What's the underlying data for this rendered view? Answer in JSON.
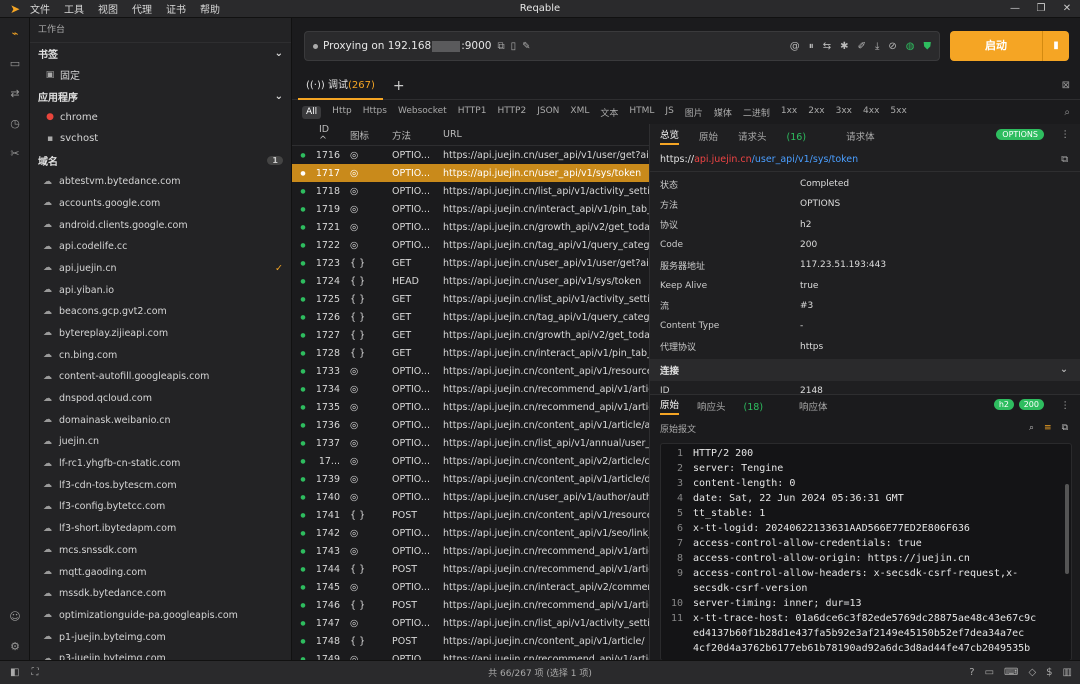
{
  "app": {
    "title": "Reqable",
    "menu": [
      "文件",
      "工具",
      "视图",
      "代理",
      "证书",
      "帮助"
    ]
  },
  "sidebar": {
    "workspace": "工作台",
    "bookmarks": {
      "title": "书签",
      "items": [
        {
          "label": "固定"
        }
      ]
    },
    "apps": {
      "title": "应用程序",
      "items": [
        {
          "label": "chrome"
        },
        {
          "label": "svchost"
        }
      ]
    },
    "domains": {
      "title": "域名",
      "badge": "1",
      "items": [
        "abtestvm.bytedance.com",
        "accounts.google.com",
        "android.clients.google.com",
        "api.codelife.cc",
        "api.juejin.cn",
        "api.yiban.io",
        "beacons.gcp.gvt2.com",
        "bytereplay.zijieapi.com",
        "cn.bing.com",
        "content-autofill.googleapis.com",
        "dnspod.qcloud.com",
        "domainask.weibanio.cn",
        "juejin.cn",
        "lf-rc1.yhgfb-cn-static.com",
        "lf3-cdn-tos.bytescm.com",
        "lf3-config.bytetcc.com",
        "lf3-short.ibytedapm.com",
        "mcs.snssdk.com",
        "mqtt.gaoding.com",
        "mssdk.bytedance.com",
        "optimizationguide-pa.googleapis.com",
        "p1-juejin.byteimg.com",
        "p3-juejin.byteimg.com"
      ],
      "checked_index": 4
    }
  },
  "proxy": {
    "status": "Proxying on 192.168",
    "port": ":9000",
    "start_label": "启动"
  },
  "tabs": {
    "debug_label": "调试",
    "debug_count": "(267)"
  },
  "filters": [
    "All",
    "Http",
    "Https",
    "Websocket",
    "HTTP1",
    "HTTP2",
    "JSON",
    "XML",
    "文本",
    "HTML",
    "JS",
    "图片",
    "媒体",
    "二进制",
    "1xx",
    "2xx",
    "3xx",
    "4xx",
    "5xx"
  ],
  "table": {
    "headers": {
      "id": "ID",
      "icon": "图标",
      "method": "方法",
      "url": "URL"
    },
    "selected_index": 1,
    "rows": [
      {
        "id": "1716",
        "icon": "◎",
        "method": "OPTIO...",
        "url": "https://api.juejin.cn/user_api/v1/user/get?aid"
      },
      {
        "id": "1717",
        "icon": "◎",
        "method": "OPTIO...",
        "url": "https://api.juejin.cn/user_api/v1/sys/token"
      },
      {
        "id": "1718",
        "icon": "◎",
        "method": "OPTIO...",
        "url": "https://api.juejin.cn/list_api/v1/activity_settin"
      },
      {
        "id": "1719",
        "icon": "◎",
        "method": "OPTIO...",
        "url": "https://api.juejin.cn/interact_api/v1/pin_tab_le"
      },
      {
        "id": "1721",
        "icon": "◎",
        "method": "OPTIO...",
        "url": "https://api.juejin.cn/growth_api/v2/get_today"
      },
      {
        "id": "1722",
        "icon": "◎",
        "method": "OPTIO...",
        "url": "https://api.juejin.cn/tag_api/v1/query_categor"
      },
      {
        "id": "1723",
        "icon": "{ }",
        "method": "GET",
        "url": "https://api.juejin.cn/user_api/v1/user/get?aid"
      },
      {
        "id": "1724",
        "icon": "{ }",
        "method": "HEAD",
        "url": "https://api.juejin.cn/user_api/v1/sys/token"
      },
      {
        "id": "1725",
        "icon": "{ }",
        "method": "GET",
        "url": "https://api.juejin.cn/list_api/v1/activity_settin"
      },
      {
        "id": "1726",
        "icon": "{ }",
        "method": "GET",
        "url": "https://api.juejin.cn/tag_api/v1/query_categor"
      },
      {
        "id": "1727",
        "icon": "{ }",
        "method": "GET",
        "url": "https://api.juejin.cn/growth_api/v2/get_today"
      },
      {
        "id": "1728",
        "icon": "{ }",
        "method": "GET",
        "url": "https://api.juejin.cn/interact_api/v1/pin_tab_le"
      },
      {
        "id": "1733",
        "icon": "◎",
        "method": "OPTIO...",
        "url": "https://api.juejin.cn/content_api/v1/resource_"
      },
      {
        "id": "1734",
        "icon": "◎",
        "method": "OPTIO...",
        "url": "https://api.juejin.cn/recommend_api/v1/articl"
      },
      {
        "id": "1735",
        "icon": "◎",
        "method": "OPTIO...",
        "url": "https://api.juejin.cn/recommend_api/v1/articl"
      },
      {
        "id": "1736",
        "icon": "◎",
        "method": "OPTIO...",
        "url": "https://api.juejin.cn/content_api/v1/article/af"
      },
      {
        "id": "1737",
        "icon": "◎",
        "method": "OPTIO...",
        "url": "https://api.juejin.cn/list_api/v1/annual/user_a"
      },
      {
        "id": "17...",
        "icon": "◎",
        "method": "OPTIO...",
        "url": "https://api.juejin.cn/content_api/v2/article/co"
      },
      {
        "id": "1739",
        "icon": "◎",
        "method": "OPTIO...",
        "url": "https://api.juejin.cn/content_api/v1/article/de"
      },
      {
        "id": "1740",
        "icon": "◎",
        "method": "OPTIO...",
        "url": "https://api.juejin.cn/user_api/v1/author/autho"
      },
      {
        "id": "1741",
        "icon": "{ }",
        "method": "POST",
        "url": "https://api.juejin.cn/content_api/v1/resource_"
      },
      {
        "id": "1742",
        "icon": "◎",
        "method": "OPTIO...",
        "url": "https://api.juejin.cn/content_api/v1/seo/link_"
      },
      {
        "id": "1743",
        "icon": "◎",
        "method": "OPTIO...",
        "url": "https://api.juejin.cn/recommend_api/v1/articl"
      },
      {
        "id": "1744",
        "icon": "{ }",
        "method": "POST",
        "url": "https://api.juejin.cn/recommend_api/v1/articl"
      },
      {
        "id": "1745",
        "icon": "◎",
        "method": "OPTIO...",
        "url": "https://api.juejin.cn/interact_api/v2/comment"
      },
      {
        "id": "1746",
        "icon": "{ }",
        "method": "POST",
        "url": "https://api.juejin.cn/recommend_api/v1/articl"
      },
      {
        "id": "1747",
        "icon": "◎",
        "method": "OPTIO...",
        "url": "https://api.juejin.cn/list_api/v1/activity_settin"
      },
      {
        "id": "1748",
        "icon": "{ }",
        "method": "POST",
        "url": "https://api.juejin.cn/content_api/v1/article/"
      },
      {
        "id": "1749",
        "icon": "◎",
        "method": "OPTIO...",
        "url": "https://api.juejin.cn/recommend_api/v1/articl"
      }
    ]
  },
  "detail": {
    "tabs": [
      "总览",
      "原始",
      "请求头",
      "请求体"
    ],
    "headers_count": "(16)",
    "method_pill": "OPTIONS",
    "url_prefix": "https://",
    "url_host": "api.juejin.cn",
    "url_path": "/user_api/v1/sys/token",
    "fields": [
      {
        "k": "状态",
        "v": "Completed"
      },
      {
        "k": "方法",
        "v": "OPTIONS"
      },
      {
        "k": "协议",
        "v": "h2"
      },
      {
        "k": "Code",
        "v": "200"
      },
      {
        "k": "服务器地址",
        "v": "117.23.51.193:443"
      },
      {
        "k": "Keep Alive",
        "v": "true"
      },
      {
        "k": "流",
        "v": "#3"
      },
      {
        "k": "Content Type",
        "v": "-"
      },
      {
        "k": "代理协议",
        "v": "https"
      }
    ],
    "section_title": "连接",
    "id_label": "ID",
    "id_value": "2148"
  },
  "response": {
    "tabs": [
      "原始",
      "响应头",
      "响应体"
    ],
    "headers_count": "(18)",
    "pill_proto": "h2",
    "pill_code": "200",
    "sub_label": "原始报文",
    "lines": [
      "HTTP/2 200",
      "server: Tengine",
      "content-length: 0",
      "date: Sat, 22 Jun 2024 05:36:31 GMT",
      "tt_stable: 1",
      "x-tt-logid: 20240622133631AAD566E77ED2E806F636",
      "access-control-allow-credentials: true",
      "access-control-allow-origin: https://juejin.cn",
      "access-control-allow-headers: x-secsdk-csrf-request,x-",
      "secsdk-csrf-version",
      "server-timing: inner; dur=13",
      "x-tt-trace-host: 01a6dce6c3f82ede5769dc28875ae48c43e67c9c",
      "ed4137b60f1b28d1e437fa5b92e3af2149e45150b52ef7dea34a7ec",
      "4cf20d4a3762b6177eb61b78190ad92a6dc3d8ad44fe47cb2049535b"
    ],
    "line_numbers": [
      "1",
      "2",
      "3",
      "4",
      "5",
      "6",
      "7",
      "8",
      "9",
      "",
      "10",
      "11",
      "",
      ""
    ]
  },
  "status": {
    "summary": "共 66/267 项 (选择 1 项)"
  }
}
